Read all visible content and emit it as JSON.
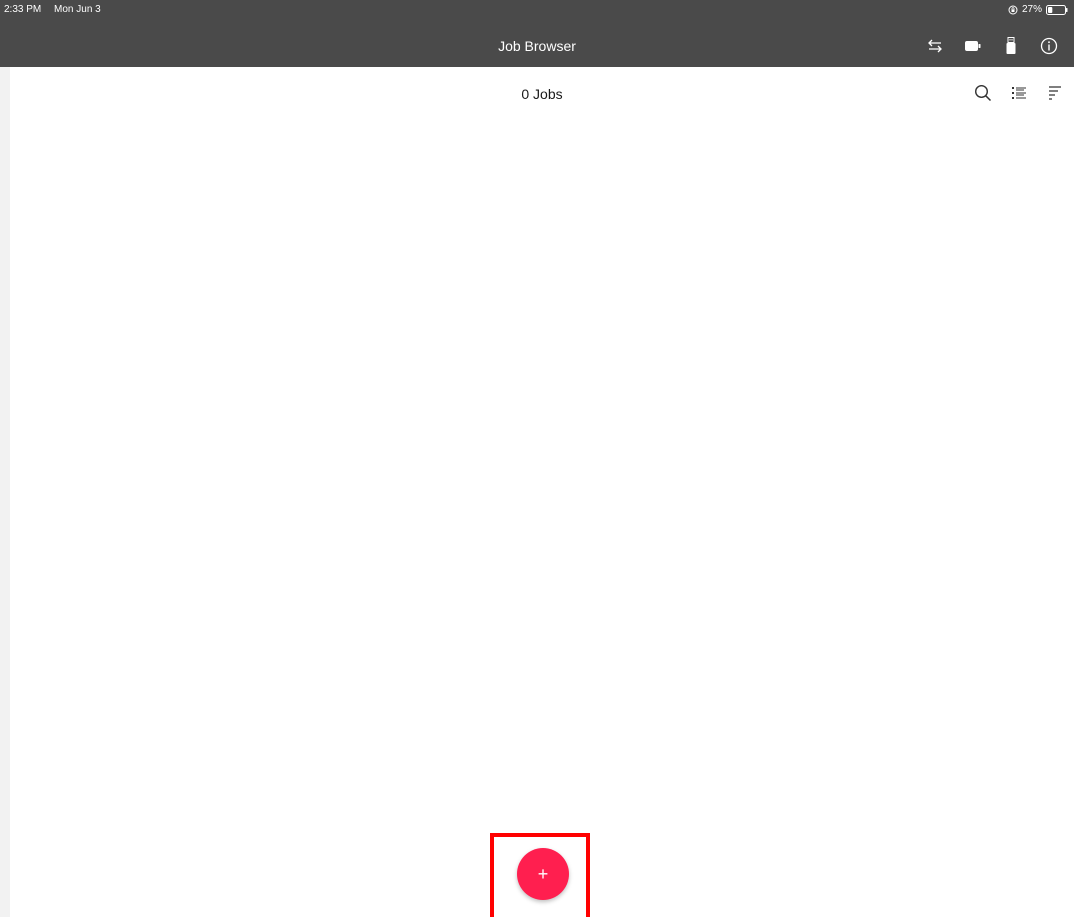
{
  "status_bar": {
    "time": "2:33 PM",
    "date": "Mon Jun 3",
    "battery": "27%",
    "battery_level": 0.27
  },
  "nav": {
    "title": "Job Browser",
    "icons": [
      "swap-arrows-icon",
      "battery-pack-icon",
      "usb-drive-icon",
      "info-icon"
    ]
  },
  "toolbar": {
    "count_label": "0 Jobs",
    "icons": [
      "search-icon",
      "list-view-icon",
      "sort-icon"
    ]
  },
  "fab": {
    "label": "+",
    "icon": "plus-icon",
    "color": "#ff1f4f",
    "highlight_color": "#ff0000"
  },
  "colors": {
    "header": "#4a4a4a",
    "background": "#ffffff"
  }
}
